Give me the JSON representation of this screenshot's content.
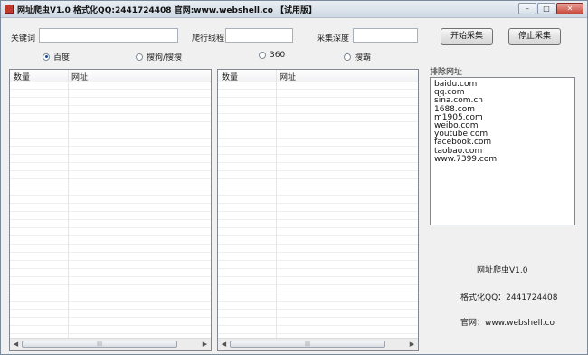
{
  "window": {
    "title": "网址爬虫V1.0 格式化QQ:2441724408 官网:www.webshell.co 【试用版】",
    "controls": {
      "minimize": "–",
      "maximize": "□",
      "close": "✕"
    }
  },
  "form": {
    "keyword_label": "关键词",
    "keyword_value": "",
    "threads_label": "爬行线程",
    "threads_value": "",
    "depth_label": "采集深度",
    "depth_value": ""
  },
  "buttons": {
    "start": "开始采集",
    "stop": "停止采集"
  },
  "engines": [
    {
      "label": "百度",
      "selected": true
    },
    {
      "label": "搜狗/搜搜",
      "selected": false
    },
    {
      "label": "360",
      "selected": false
    },
    {
      "label": "搜霸",
      "selected": false
    }
  ],
  "list_left": {
    "col_count": "数量",
    "col_url": "网址"
  },
  "list_right": {
    "col_count": "数量",
    "col_url": "网址"
  },
  "exclude": {
    "title": "排除网址",
    "urls": [
      "baidu.com",
      "qq.com",
      "sina.com.cn",
      "1688.com",
      "m1905.com",
      "weibo.com",
      "youtube.com",
      "facebook.com",
      "taobao.com",
      "www.7399.com"
    ]
  },
  "info": {
    "app": "网址爬虫V1.0",
    "qq": "格式化QQ：2441724408",
    "site": "官网：www.webshell.co"
  },
  "scrollbar": {
    "left_arrow": "◀",
    "right_arrow": "▶",
    "thumb_grip": "|||"
  }
}
